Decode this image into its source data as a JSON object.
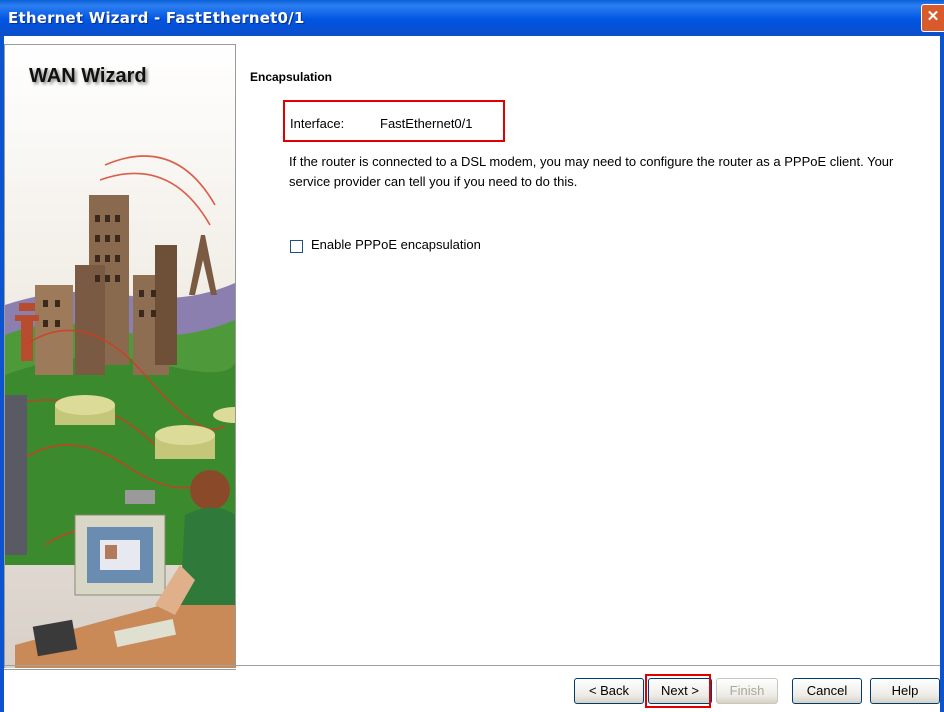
{
  "window": {
    "title": "Ethernet Wizard - FastEthernet0/1",
    "close_glyph": "✕"
  },
  "side_panel": {
    "title": "WAN Wizard",
    "illustration": "city-network-illustration"
  },
  "main": {
    "section_title": "Encapsulation",
    "interface_label": "Interface:",
    "interface_value": "FastEthernet0/1",
    "description": "If the router is connected to a DSL modem, you may need to configure the router as a PPPoE client. Your service provider can tell you if you need to do this.",
    "pppoe_checkbox": {
      "label": "Enable PPPoE encapsulation",
      "checked": false
    }
  },
  "buttons": {
    "back": "< Back",
    "next": "Next >",
    "finish": "Finish",
    "cancel": "Cancel",
    "help": "Help"
  },
  "colors": {
    "titlebar": "#0054e3",
    "highlight": "#e00000"
  }
}
